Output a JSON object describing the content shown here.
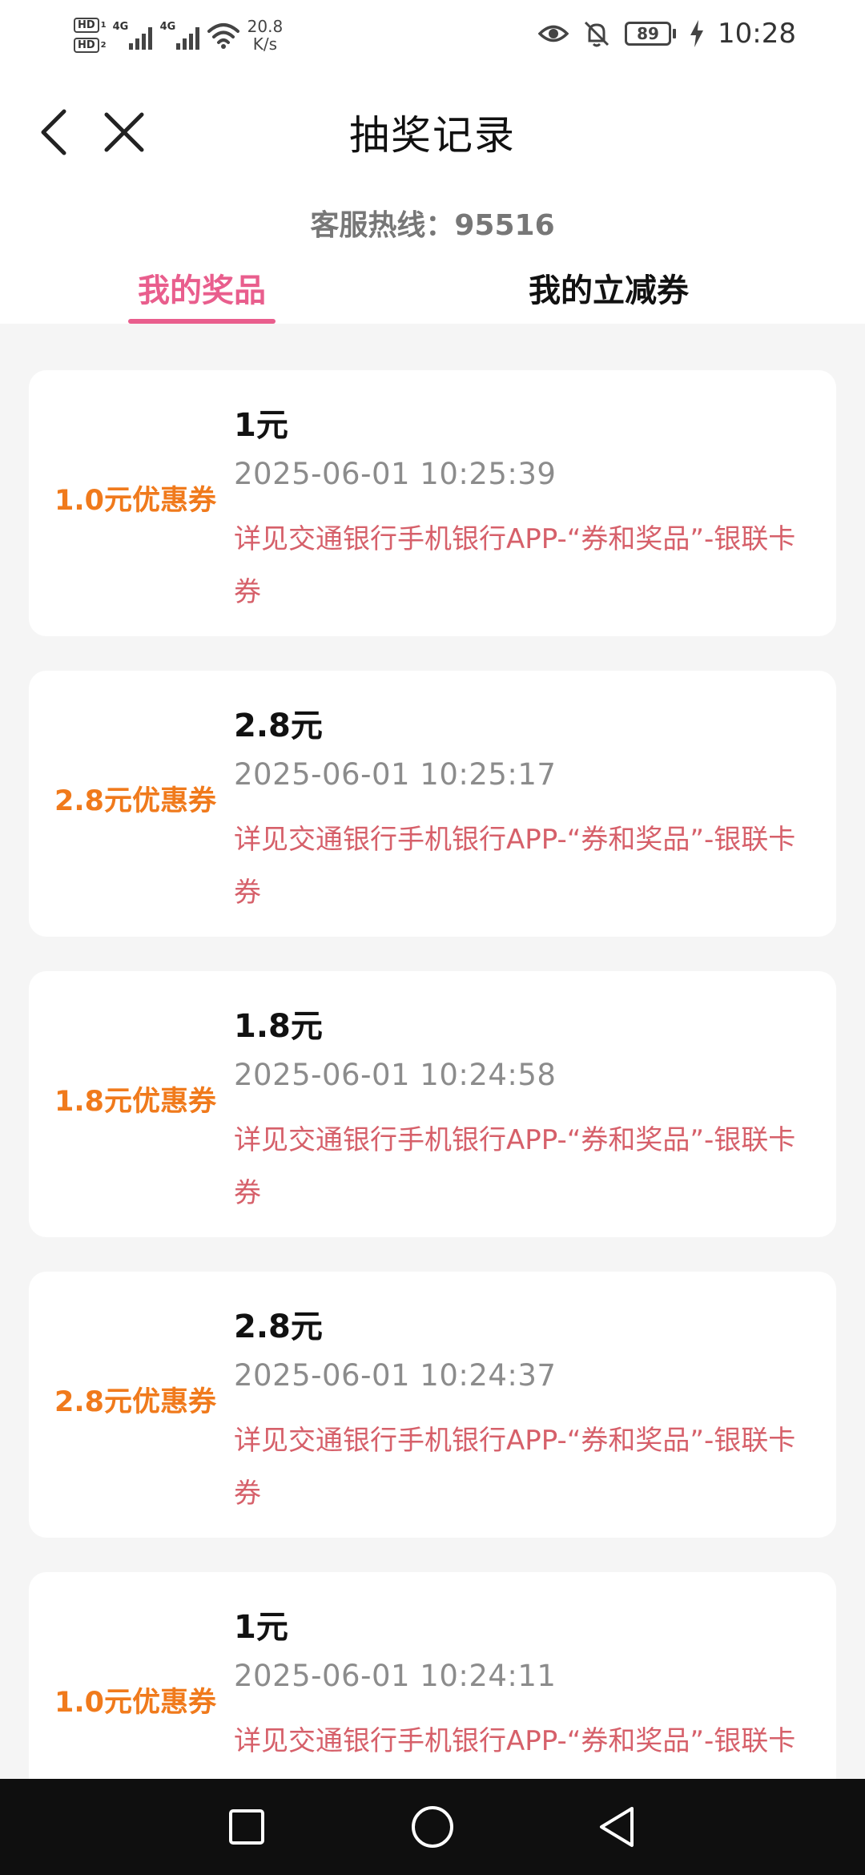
{
  "status_bar": {
    "hd1_label": "HD",
    "hd1_num": "1",
    "hd2_label": "HD",
    "hd2_num": "2",
    "sig1_tag": "4G",
    "sig2_tag": "4G",
    "speed_value": "20.8",
    "speed_unit": "K/s",
    "battery_level": "89",
    "time": "10:28"
  },
  "header": {
    "title": "抽奖记录",
    "back_icon": "chevron-left-icon",
    "close_icon": "close-icon"
  },
  "hotline": "客服热线：95516",
  "tabs": [
    {
      "label": "我的奖品",
      "active": true
    },
    {
      "label": "我的立减券",
      "active": false
    }
  ],
  "records": [
    {
      "coupon": "1.0元优惠券",
      "amount": "1元",
      "time": "2025-06-01 10:25:39",
      "desc": "详见交通银行手机银行APP-“券和奖品”-银联卡券"
    },
    {
      "coupon": "2.8元优惠券",
      "amount": "2.8元",
      "time": "2025-06-01 10:25:17",
      "desc": "详见交通银行手机银行APP-“券和奖品”-银联卡券"
    },
    {
      "coupon": "1.8元优惠券",
      "amount": "1.8元",
      "time": "2025-06-01 10:24:58",
      "desc": "详见交通银行手机银行APP-“券和奖品”-银联卡券"
    },
    {
      "coupon": "2.8元优惠券",
      "amount": "2.8元",
      "time": "2025-06-01 10:24:37",
      "desc": "详见交通银行手机银行APP-“券和奖品”-银联卡券"
    },
    {
      "coupon": "1.0元优惠券",
      "amount": "1元",
      "time": "2025-06-01 10:24:11",
      "desc": "详见交通银行手机银行APP-“券和奖品”-银联卡券"
    }
  ],
  "colors": {
    "accent_pink": "#e95e8d",
    "coupon_orange": "#f07a1c",
    "desc_red": "#d6606a",
    "list_bg": "#f5f5f5"
  },
  "nav_bar": {
    "recent_icon": "square-icon",
    "home_icon": "circle-icon",
    "back_icon": "triangle-back-icon"
  }
}
